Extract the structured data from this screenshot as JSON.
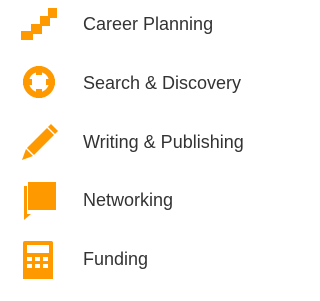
{
  "accent_color": "#ff9900",
  "menu": {
    "items": [
      {
        "label": "Career Planning",
        "icon": "stairs-icon"
      },
      {
        "label": "Search & Discovery",
        "icon": "crosshair-icon"
      },
      {
        "label": "Writing & Publishing",
        "icon": "pencil-icon"
      },
      {
        "label": "Networking",
        "icon": "chat-bubble-icon"
      },
      {
        "label": "Funding",
        "icon": "calculator-icon"
      }
    ]
  }
}
